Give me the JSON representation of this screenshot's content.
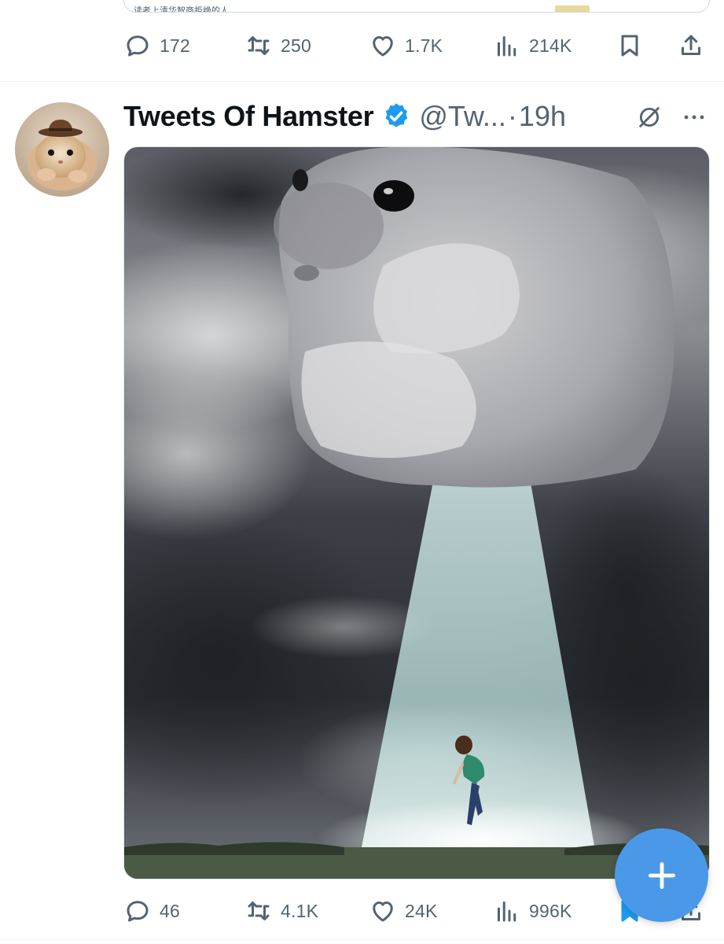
{
  "quoted_card": {
    "snippet": "读者上清华智商拒绝的人"
  },
  "tweet_prev": {
    "replies": "172",
    "retweets": "250",
    "likes": "1.7K",
    "views": "214K"
  },
  "tweet": {
    "display_name": "Tweets Of Hamster",
    "handle": "@Tw...",
    "separator": "·",
    "time": "19h",
    "replies": "46",
    "retweets": "4.1K",
    "likes": "24K",
    "views": "996K"
  },
  "colors": {
    "accent": "#1d9bf0",
    "fab": "#4a99e9",
    "muted": "#536471",
    "text": "#0f1419"
  },
  "icons": {
    "reply": "reply-icon",
    "retweet": "retweet-icon",
    "like": "heart-icon",
    "views": "views-icon",
    "bookmark": "bookmark-icon",
    "share": "share-icon",
    "verified": "verified-badge-icon",
    "grok": "grok-icon",
    "more": "more-icon",
    "compose": "plus-icon"
  }
}
